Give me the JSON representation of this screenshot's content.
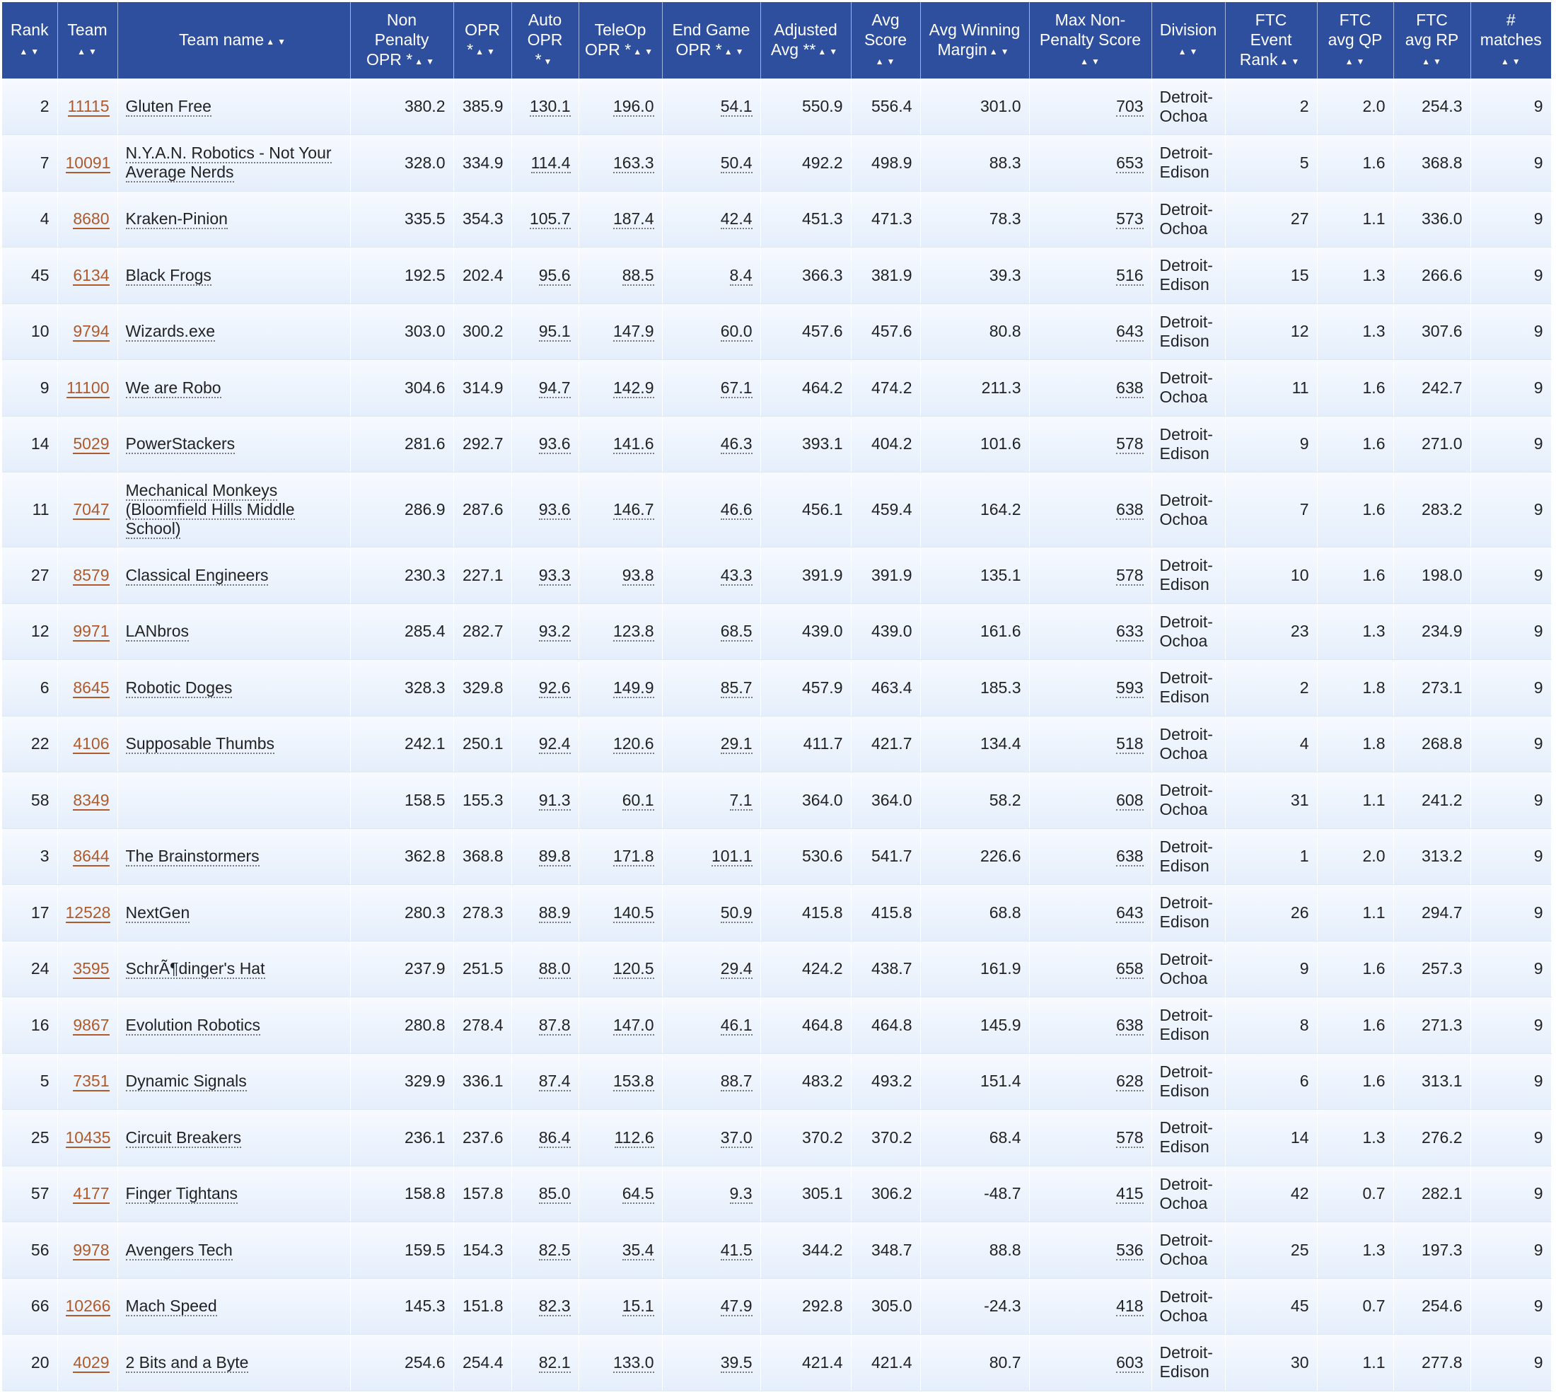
{
  "headers": [
    {
      "lines": [
        "Rank"
      ],
      "sort": "▲▼"
    },
    {
      "lines": [
        "Team"
      ],
      "sort": "▲▼"
    },
    {
      "lines": [
        "Team name"
      ],
      "sort": "▲▼"
    },
    {
      "lines": [
        "Non",
        "Penalty",
        "OPR *"
      ],
      "sort": "▲▼"
    },
    {
      "lines": [
        "OPR",
        "*"
      ],
      "sort": "▲▼"
    },
    {
      "lines": [
        "Auto",
        "OPR",
        "*"
      ],
      "sort": "▼"
    },
    {
      "lines": [
        "TeleOp",
        "OPR *"
      ],
      "sort": "▲▼"
    },
    {
      "lines": [
        "End Game",
        "OPR *"
      ],
      "sort": "▲▼"
    },
    {
      "lines": [
        "Adjusted",
        "Avg **"
      ],
      "sort": "▲▼"
    },
    {
      "lines": [
        "Avg",
        "Score"
      ],
      "sort": "▲▼"
    },
    {
      "lines": [
        "Avg Winning",
        "Margin"
      ],
      "sort": "▲▼"
    },
    {
      "lines": [
        "Max Non-",
        "Penalty Score"
      ],
      "sort": "▲▼"
    },
    {
      "lines": [
        "Division"
      ],
      "sort": "▲▼"
    },
    {
      "lines": [
        "FTC",
        "Event",
        "Rank"
      ],
      "sort": "▲▼"
    },
    {
      "lines": [
        "FTC",
        "avg QP"
      ],
      "sort": "▲▼"
    },
    {
      "lines": [
        "FTC",
        "avg RP"
      ],
      "sort": "▲▼"
    },
    {
      "lines": [
        "#",
        "matches"
      ],
      "sort": "▲▼"
    }
  ],
  "rows": [
    {
      "rank": "2",
      "team": "11115",
      "name": "Gluten Free",
      "np_opr": "380.2",
      "opr": "385.9",
      "auto": "130.1",
      "teleop": "196.0",
      "endgame": "54.1",
      "adj": "550.9",
      "avg": "556.4",
      "margin": "301.0",
      "max": "703",
      "division": [
        "Detroit-",
        "Ochoa"
      ],
      "ev_rank": "2",
      "qp": "2.0",
      "rp": "254.3",
      "matches": "9"
    },
    {
      "rank": "7",
      "team": "10091",
      "name": "N.Y.A.N. Robotics - Not Your Average Nerds",
      "np_opr": "328.0",
      "opr": "334.9",
      "auto": "114.4",
      "teleop": "163.3",
      "endgame": "50.4",
      "adj": "492.2",
      "avg": "498.9",
      "margin": "88.3",
      "max": "653",
      "division": [
        "Detroit-",
        "Edison"
      ],
      "ev_rank": "5",
      "qp": "1.6",
      "rp": "368.8",
      "matches": "9"
    },
    {
      "rank": "4",
      "team": "8680",
      "name": "Kraken-Pinion",
      "np_opr": "335.5",
      "opr": "354.3",
      "auto": "105.7",
      "teleop": "187.4",
      "endgame": "42.4",
      "adj": "451.3",
      "avg": "471.3",
      "margin": "78.3",
      "max": "573",
      "division": [
        "Detroit-",
        "Ochoa"
      ],
      "ev_rank": "27",
      "qp": "1.1",
      "rp": "336.0",
      "matches": "9"
    },
    {
      "rank": "45",
      "team": "6134",
      "name": "Black Frogs",
      "np_opr": "192.5",
      "opr": "202.4",
      "auto": "95.6",
      "teleop": "88.5",
      "endgame": "8.4",
      "adj": "366.3",
      "avg": "381.9",
      "margin": "39.3",
      "max": "516",
      "division": [
        "Detroit-",
        "Edison"
      ],
      "ev_rank": "15",
      "qp": "1.3",
      "rp": "266.6",
      "matches": "9"
    },
    {
      "rank": "10",
      "team": "9794",
      "name": "Wizards.exe",
      "np_opr": "303.0",
      "opr": "300.2",
      "auto": "95.1",
      "teleop": "147.9",
      "endgame": "60.0",
      "adj": "457.6",
      "avg": "457.6",
      "margin": "80.8",
      "max": "643",
      "division": [
        "Detroit-",
        "Edison"
      ],
      "ev_rank": "12",
      "qp": "1.3",
      "rp": "307.6",
      "matches": "9"
    },
    {
      "rank": "9",
      "team": "11100",
      "name": "We are Robo",
      "np_opr": "304.6",
      "opr": "314.9",
      "auto": "94.7",
      "teleop": "142.9",
      "endgame": "67.1",
      "adj": "464.2",
      "avg": "474.2",
      "margin": "211.3",
      "max": "638",
      "division": [
        "Detroit-",
        "Ochoa"
      ],
      "ev_rank": "11",
      "qp": "1.6",
      "rp": "242.7",
      "matches": "9"
    },
    {
      "rank": "14",
      "team": "5029",
      "name": "PowerStackers",
      "np_opr": "281.6",
      "opr": "292.7",
      "auto": "93.6",
      "teleop": "141.6",
      "endgame": "46.3",
      "adj": "393.1",
      "avg": "404.2",
      "margin": "101.6",
      "max": "578",
      "division": [
        "Detroit-",
        "Edison"
      ],
      "ev_rank": "9",
      "qp": "1.6",
      "rp": "271.0",
      "matches": "9"
    },
    {
      "rank": "11",
      "team": "7047",
      "name": "Mechanical Monkeys (Bloomfield Hills Middle School)",
      "np_opr": "286.9",
      "opr": "287.6",
      "auto": "93.6",
      "teleop": "146.7",
      "endgame": "46.6",
      "adj": "456.1",
      "avg": "459.4",
      "margin": "164.2",
      "max": "638",
      "division": [
        "Detroit-",
        "Ochoa"
      ],
      "ev_rank": "7",
      "qp": "1.6",
      "rp": "283.2",
      "matches": "9",
      "tall": true
    },
    {
      "rank": "27",
      "team": "8579",
      "name": "Classical Engineers",
      "np_opr": "230.3",
      "opr": "227.1",
      "auto": "93.3",
      "teleop": "93.8",
      "endgame": "43.3",
      "adj": "391.9",
      "avg": "391.9",
      "margin": "135.1",
      "max": "578",
      "division": [
        "Detroit-",
        "Edison"
      ],
      "ev_rank": "10",
      "qp": "1.6",
      "rp": "198.0",
      "matches": "9"
    },
    {
      "rank": "12",
      "team": "9971",
      "name": "LANbros",
      "np_opr": "285.4",
      "opr": "282.7",
      "auto": "93.2",
      "teleop": "123.8",
      "endgame": "68.5",
      "adj": "439.0",
      "avg": "439.0",
      "margin": "161.6",
      "max": "633",
      "division": [
        "Detroit-",
        "Ochoa"
      ],
      "ev_rank": "23",
      "qp": "1.3",
      "rp": "234.9",
      "matches": "9"
    },
    {
      "rank": "6",
      "team": "8645",
      "name": "Robotic Doges",
      "np_opr": "328.3",
      "opr": "329.8",
      "auto": "92.6",
      "teleop": "149.9",
      "endgame": "85.7",
      "adj": "457.9",
      "avg": "463.4",
      "margin": "185.3",
      "max": "593",
      "division": [
        "Detroit-",
        "Edison"
      ],
      "ev_rank": "2",
      "qp": "1.8",
      "rp": "273.1",
      "matches": "9"
    },
    {
      "rank": "22",
      "team": "4106",
      "name": "Supposable Thumbs",
      "np_opr": "242.1",
      "opr": "250.1",
      "auto": "92.4",
      "teleop": "120.6",
      "endgame": "29.1",
      "adj": "411.7",
      "avg": "421.7",
      "margin": "134.4",
      "max": "518",
      "division": [
        "Detroit-",
        "Ochoa"
      ],
      "ev_rank": "4",
      "qp": "1.8",
      "rp": "268.8",
      "matches": "9"
    },
    {
      "rank": "58",
      "team": "8349",
      "name": "",
      "np_opr": "158.5",
      "opr": "155.3",
      "auto": "91.3",
      "teleop": "60.1",
      "endgame": "7.1",
      "adj": "364.0",
      "avg": "364.0",
      "margin": "58.2",
      "max": "608",
      "division": [
        "Detroit-",
        "Ochoa"
      ],
      "ev_rank": "31",
      "qp": "1.1",
      "rp": "241.2",
      "matches": "9"
    },
    {
      "rank": "3",
      "team": "8644",
      "name": "The Brainstormers",
      "np_opr": "362.8",
      "opr": "368.8",
      "auto": "89.8",
      "teleop": "171.8",
      "endgame": "101.1",
      "adj": "530.6",
      "avg": "541.7",
      "margin": "226.6",
      "max": "638",
      "division": [
        "Detroit-",
        "Edison"
      ],
      "ev_rank": "1",
      "qp": "2.0",
      "rp": "313.2",
      "matches": "9"
    },
    {
      "rank": "17",
      "team": "12528",
      "name": "NextGen",
      "np_opr": "280.3",
      "opr": "278.3",
      "auto": "88.9",
      "teleop": "140.5",
      "endgame": "50.9",
      "adj": "415.8",
      "avg": "415.8",
      "margin": "68.8",
      "max": "643",
      "division": [
        "Detroit-",
        "Edison"
      ],
      "ev_rank": "26",
      "qp": "1.1",
      "rp": "294.7",
      "matches": "9"
    },
    {
      "rank": "24",
      "team": "3595",
      "name": "SchrÃ¶dinger's Hat",
      "np_opr": "237.9",
      "opr": "251.5",
      "auto": "88.0",
      "teleop": "120.5",
      "endgame": "29.4",
      "adj": "424.2",
      "avg": "438.7",
      "margin": "161.9",
      "max": "658",
      "division": [
        "Detroit-",
        "Ochoa"
      ],
      "ev_rank": "9",
      "qp": "1.6",
      "rp": "257.3",
      "matches": "9"
    },
    {
      "rank": "16",
      "team": "9867",
      "name": "Evolution Robotics",
      "np_opr": "280.8",
      "opr": "278.4",
      "auto": "87.8",
      "teleop": "147.0",
      "endgame": "46.1",
      "adj": "464.8",
      "avg": "464.8",
      "margin": "145.9",
      "max": "638",
      "division": [
        "Detroit-",
        "Edison"
      ],
      "ev_rank": "8",
      "qp": "1.6",
      "rp": "271.3",
      "matches": "9"
    },
    {
      "rank": "5",
      "team": "7351",
      "name": "Dynamic Signals",
      "np_opr": "329.9",
      "opr": "336.1",
      "auto": "87.4",
      "teleop": "153.8",
      "endgame": "88.7",
      "adj": "483.2",
      "avg": "493.2",
      "margin": "151.4",
      "max": "628",
      "division": [
        "Detroit-",
        "Edison"
      ],
      "ev_rank": "6",
      "qp": "1.6",
      "rp": "313.1",
      "matches": "9"
    },
    {
      "rank": "25",
      "team": "10435",
      "name": "Circuit Breakers",
      "np_opr": "236.1",
      "opr": "237.6",
      "auto": "86.4",
      "teleop": "112.6",
      "endgame": "37.0",
      "adj": "370.2",
      "avg": "370.2",
      "margin": "68.4",
      "max": "578",
      "division": [
        "Detroit-",
        "Edison"
      ],
      "ev_rank": "14",
      "qp": "1.3",
      "rp": "276.2",
      "matches": "9"
    },
    {
      "rank": "57",
      "team": "4177",
      "name": "Finger Tightans",
      "np_opr": "158.8",
      "opr": "157.8",
      "auto": "85.0",
      "teleop": "64.5",
      "endgame": "9.3",
      "adj": "305.1",
      "avg": "306.2",
      "margin": "-48.7",
      "max": "415",
      "division": [
        "Detroit-",
        "Ochoa"
      ],
      "ev_rank": "42",
      "qp": "0.7",
      "rp": "282.1",
      "matches": "9"
    },
    {
      "rank": "56",
      "team": "9978",
      "name": "Avengers Tech",
      "np_opr": "159.5",
      "opr": "154.3",
      "auto": "82.5",
      "teleop": "35.4",
      "endgame": "41.5",
      "adj": "344.2",
      "avg": "348.7",
      "margin": "88.8",
      "max": "536",
      "division": [
        "Detroit-",
        "Ochoa"
      ],
      "ev_rank": "25",
      "qp": "1.3",
      "rp": "197.3",
      "matches": "9"
    },
    {
      "rank": "66",
      "team": "10266",
      "name": "Mach Speed",
      "np_opr": "145.3",
      "opr": "151.8",
      "auto": "82.3",
      "teleop": "15.1",
      "endgame": "47.9",
      "adj": "292.8",
      "avg": "305.0",
      "margin": "-24.3",
      "max": "418",
      "division": [
        "Detroit-",
        "Ochoa"
      ],
      "ev_rank": "45",
      "qp": "0.7",
      "rp": "254.6",
      "matches": "9"
    },
    {
      "rank": "20",
      "team": "4029",
      "name": "2 Bits and a Byte",
      "np_opr": "254.6",
      "opr": "254.4",
      "auto": "82.1",
      "teleop": "133.0",
      "endgame": "39.5",
      "adj": "421.4",
      "avg": "421.4",
      "margin": "80.7",
      "max": "603",
      "division": [
        "Detroit-",
        "Edison"
      ],
      "ev_rank": "30",
      "qp": "1.1",
      "rp": "277.8",
      "matches": "9"
    }
  ]
}
